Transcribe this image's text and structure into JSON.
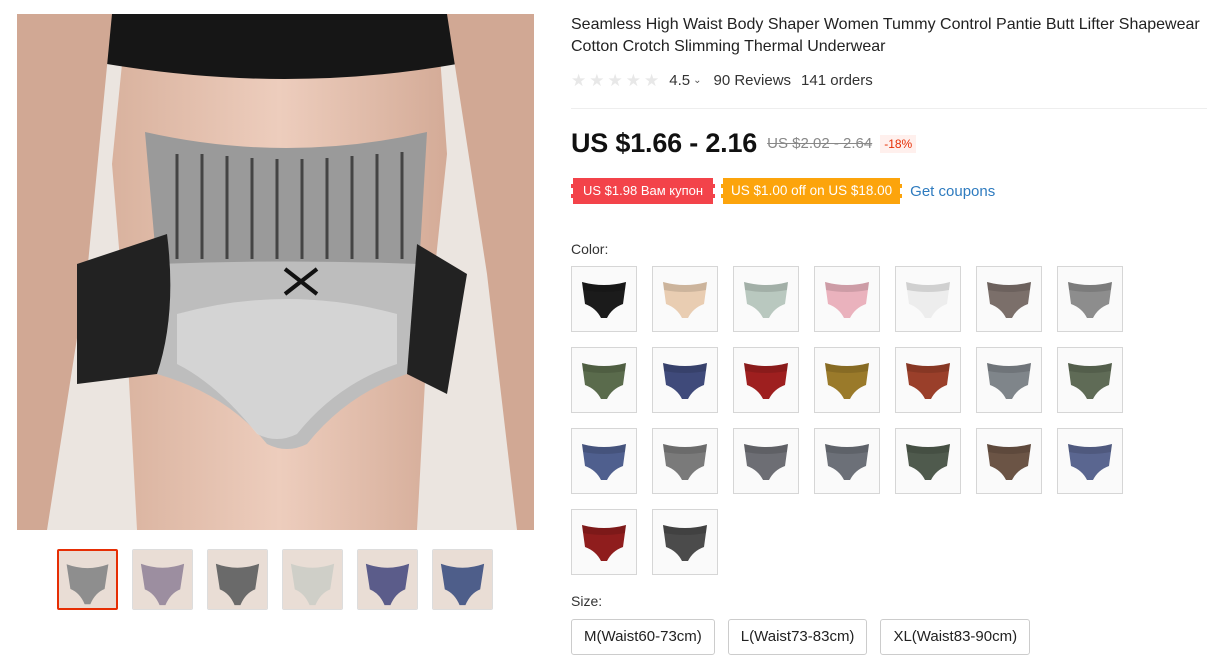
{
  "product": {
    "title": "Seamless High Waist Body Shaper Women Tummy Control Pantie Butt Lifter Shapewear Cotton Crotch Slimming Thermal Underwear",
    "rating": "4.5",
    "rating_stars": 0,
    "reviews": "90 Reviews",
    "orders": "141 orders"
  },
  "price": {
    "current": "US $1.66 - 2.16",
    "original": "US $2.02 - 2.64",
    "discount": "-18%"
  },
  "coupons": {
    "red": "US $1.98 Вам купон",
    "orange": "US $1.00 off on US $18.00",
    "get": "Get coupons"
  },
  "color_label": "Color:",
  "size_label": "Size:",
  "swatch_colors": [
    "#1b1b1b",
    "#e9cdb2",
    "#b9c8bf",
    "#eab2bd",
    "#ededed",
    "#7b6f6a",
    "#8d8d8d",
    "#5a6b4c",
    "#3f4a7a",
    "#9e1f1f",
    "#9a7a2a",
    "#9a3f2a",
    "#7f858a",
    "#5f6b56",
    "#4f5f8e",
    "#7a7a7a",
    "#6d6e74",
    "#6c7078",
    "#4f5a4d",
    "#6b5445",
    "#5a6690",
    "#8f1d1d",
    "#4b4b4b"
  ],
  "sizes": [
    "M(Waist60-73cm)",
    "L(Waist73-83cm)",
    "XL(Waist83-90cm)"
  ],
  "thumbnails": [
    "#8e8e8e",
    "#9c8ea0",
    "#6a6a6a",
    "#cfcfc8",
    "#5b5c8a",
    "#4e5e8a"
  ]
}
